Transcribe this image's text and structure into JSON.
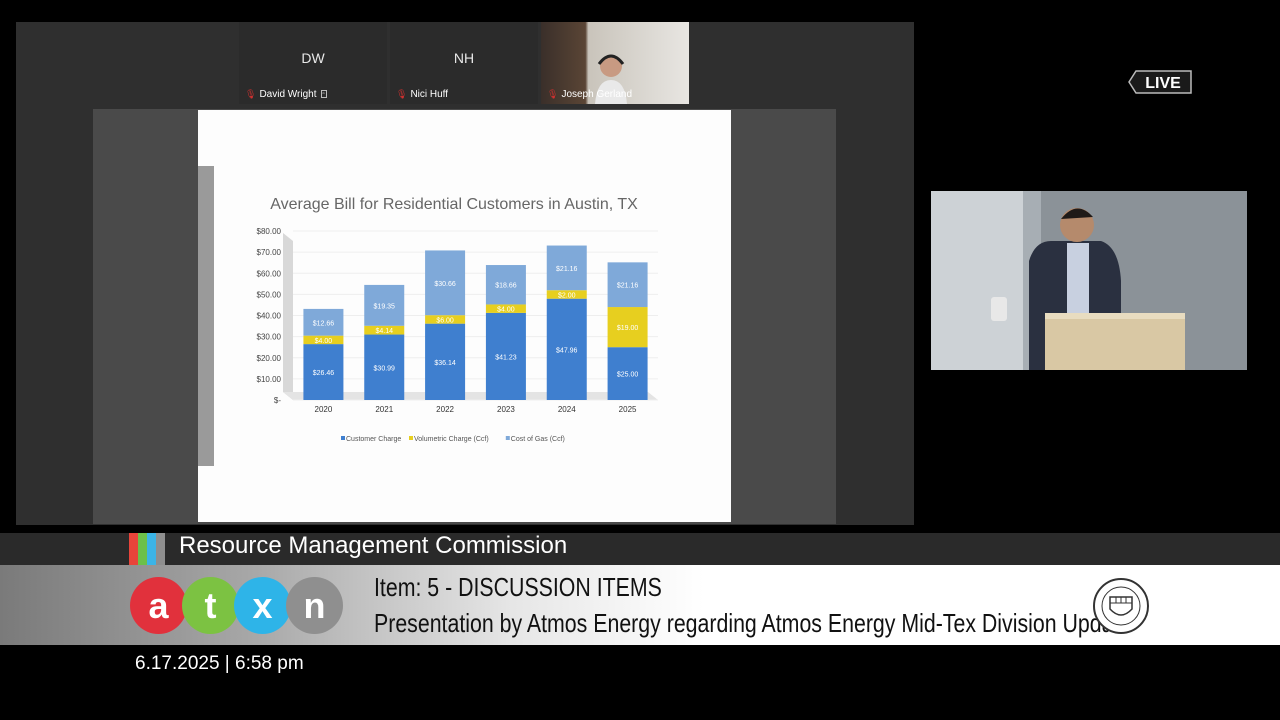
{
  "participants": [
    {
      "initials": "DW",
      "name": "David Wright",
      "cc": "▫"
    },
    {
      "initials": "NH",
      "name": "Nici Huff"
    },
    {
      "initials": "",
      "name": "Joseph Gerland"
    }
  ],
  "live_label": "LIVE",
  "slide": {
    "chart_data": {
      "type": "bar",
      "title": "Average Bill for Residential Customers in Austin, TX",
      "categories": [
        "2020",
        "2021",
        "2022",
        "2023",
        "2024",
        "2025"
      ],
      "y_ticks": [
        "$-",
        "$10.00",
        "$20.00",
        "$30.00",
        "$40.00",
        "$50.00",
        "$60.00",
        "$70.00",
        "$80.00"
      ],
      "ylim": [
        0,
        80
      ],
      "stacked": true,
      "series": [
        {
          "name": "Customer Charge",
          "color": "#3f7fcf",
          "values": [
            26.46,
            30.99,
            36.14,
            41.23,
            47.96,
            25.0
          ],
          "labels": [
            "$26.46",
            "$30.99",
            "$36.14",
            "$41.23",
            "$47.96",
            "$25.00"
          ]
        },
        {
          "name": "Volumetric Charge (Ccf)",
          "color": "#e7cf1f",
          "values": [
            4.0,
            4.14,
            4.0,
            4.0,
            4.0,
            19.0
          ],
          "labels": [
            "$4.00",
            "$4.14",
            "$6.00",
            "$4.00",
            "$2.00",
            "$19.00"
          ]
        },
        {
          "name": "Cost of Gas (Ccf)",
          "color": "#7fa9d9",
          "values": [
            12.66,
            19.35,
            30.66,
            18.66,
            21.16,
            21.16
          ],
          "labels": [
            "$12.66",
            "$19.35",
            "$30.66",
            "$18.66",
            "$21.16",
            "$21.16"
          ]
        }
      ],
      "legend_position": "bottom"
    }
  },
  "lower_third": {
    "commission": "Resource Management Commission",
    "logo_letters": [
      "a",
      "t",
      "x",
      "n"
    ],
    "item": "Item: 5 - DISCUSSION ITEMS",
    "description": "Presentation by Atmos Energy regarding Atmos Energy Mid-Tex Division Update",
    "datetime": "6.17.2025 | 6:58 pm"
  }
}
